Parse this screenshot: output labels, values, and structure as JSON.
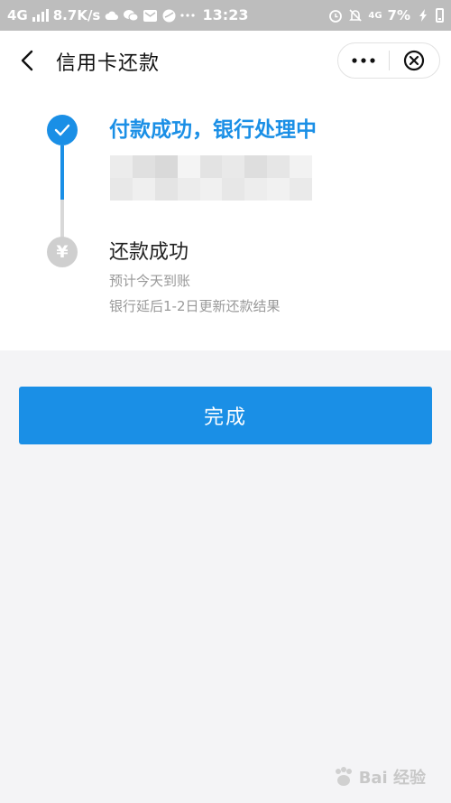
{
  "status_bar": {
    "network": "4G",
    "speed": "8.7K/s",
    "time": "13:23",
    "network_right": "4G",
    "battery": "7%"
  },
  "nav": {
    "title": "信用卡还款"
  },
  "steps": [
    {
      "title": "付款成功，银行处理中"
    },
    {
      "title": "还款成功",
      "subtitle_1": "预计今天到账",
      "subtitle_2": "银行延后1-2日更新还款结果",
      "icon_glyph": "¥"
    }
  ],
  "done_button": {
    "label": "完成"
  },
  "watermark": {
    "text": "Bai  经验"
  },
  "colors": {
    "accent": "#1a8fe6",
    "inactive": "#cfcfcf"
  }
}
